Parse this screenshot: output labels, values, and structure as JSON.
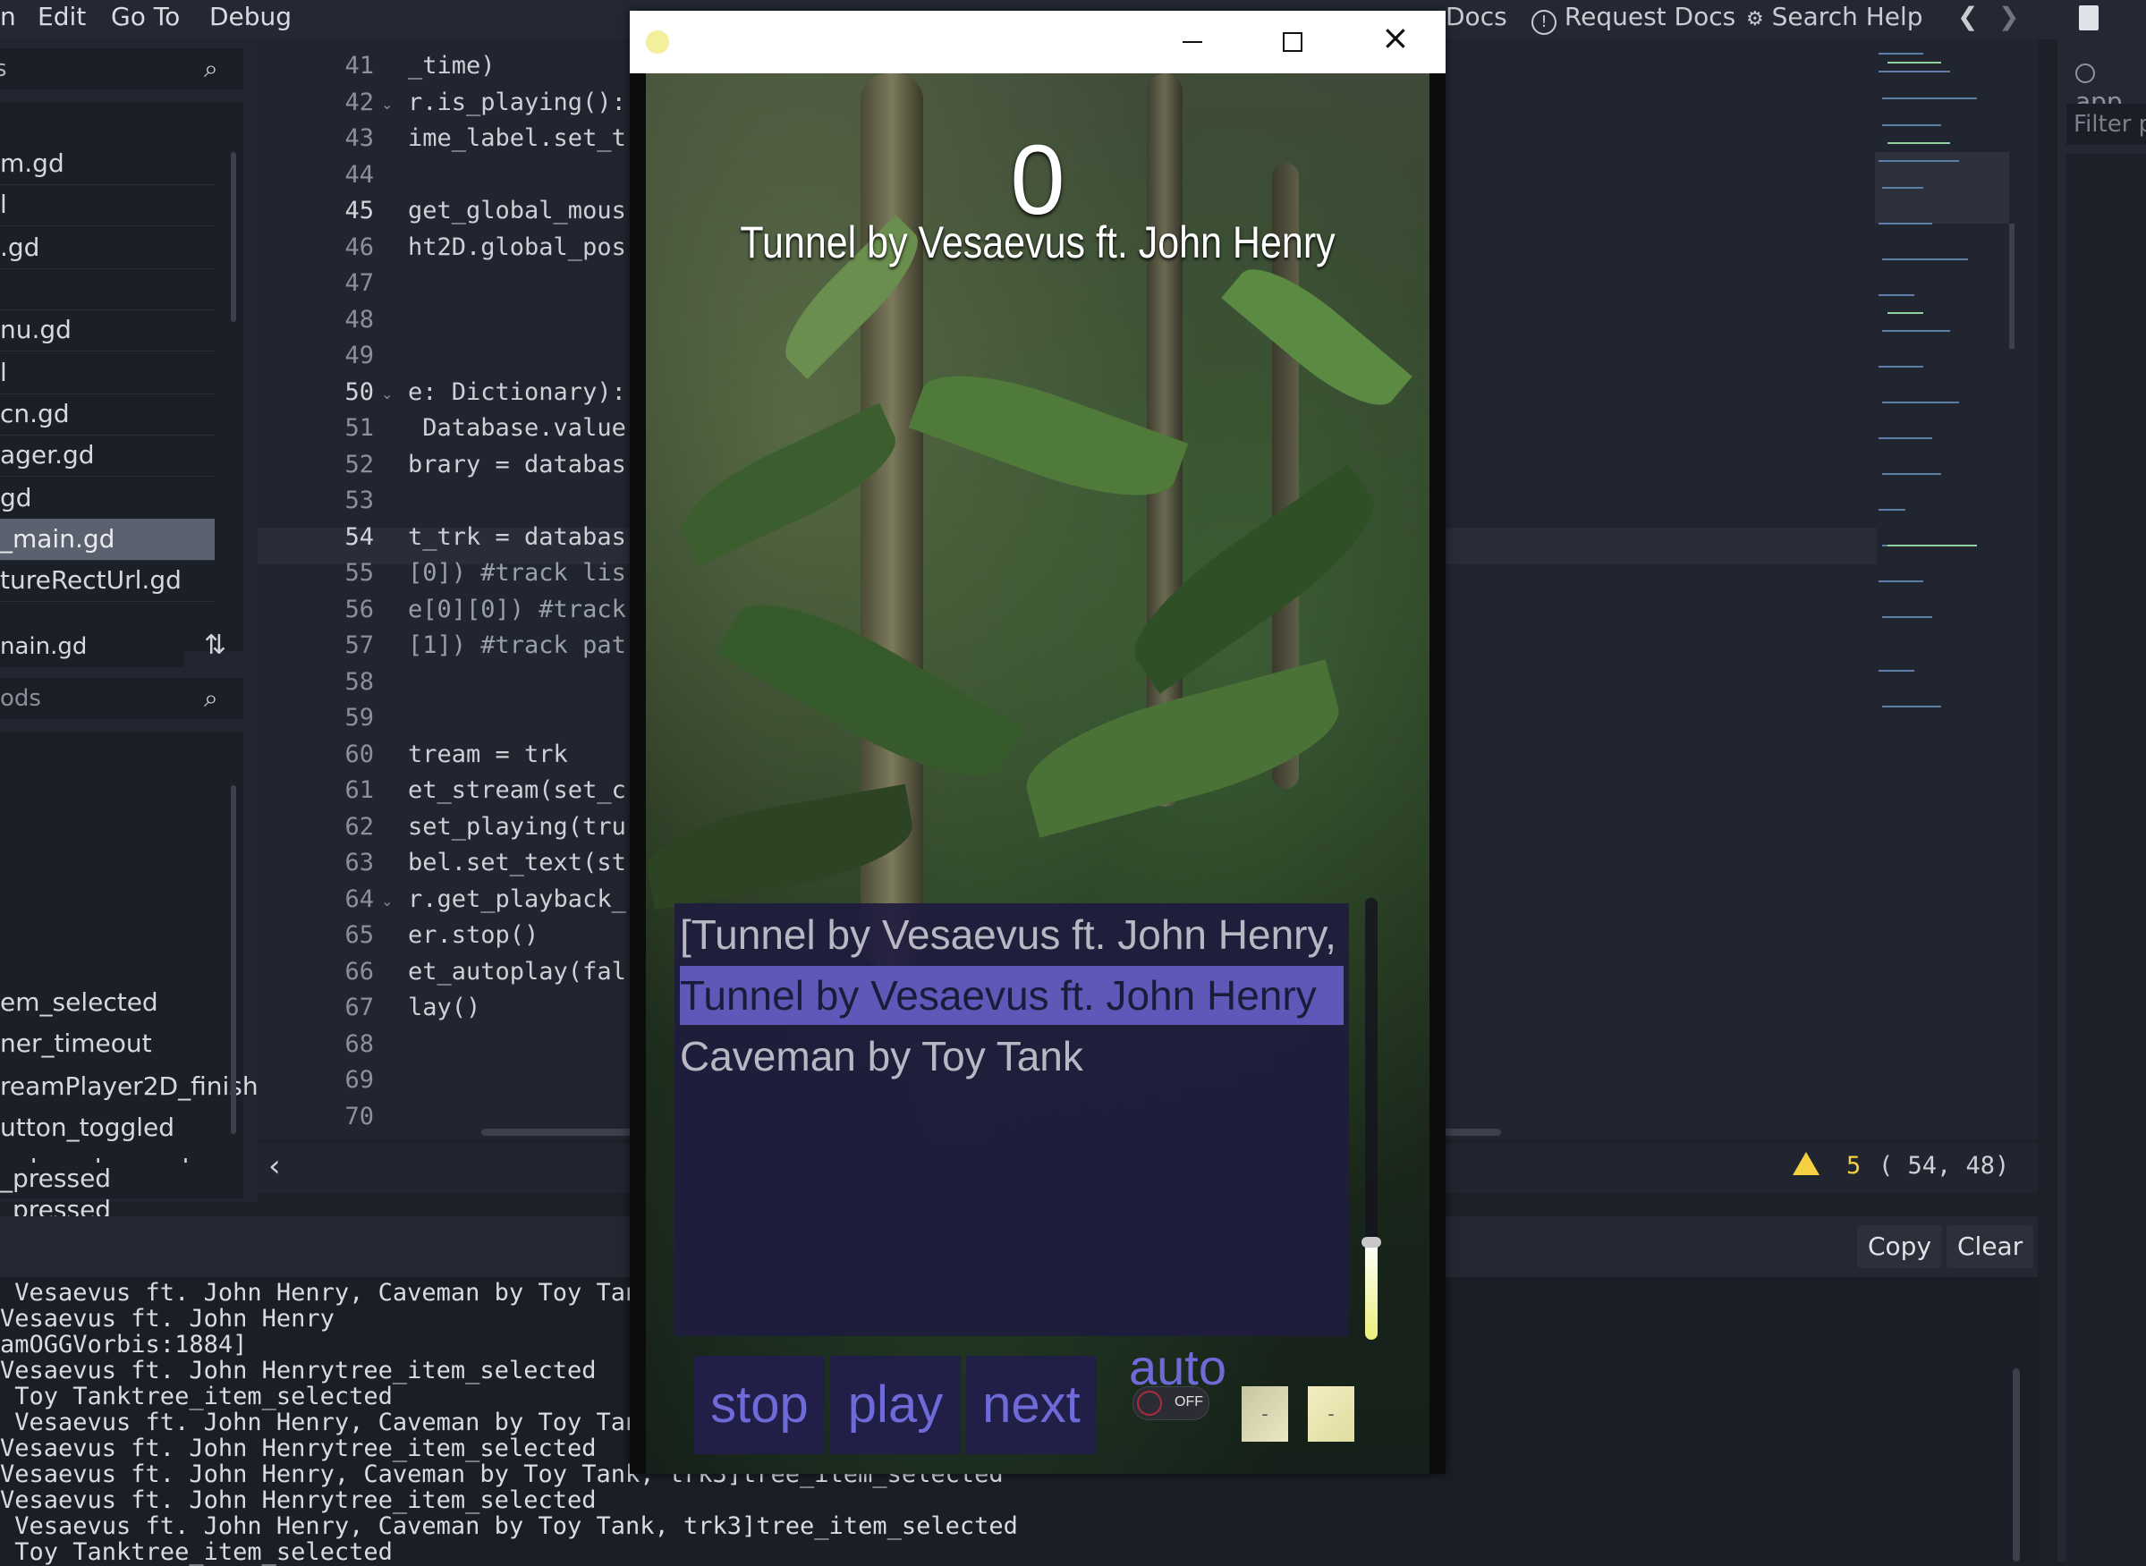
{
  "menu": {
    "items": [
      "n",
      "Edit",
      "Go To",
      "Debug"
    ]
  },
  "topright": {
    "online_docs": "Docs",
    "request_docs": "Request Docs",
    "search_help": "Search Help",
    "back": "❮",
    "forward": "❯"
  },
  "filesystem": {
    "files": [
      "m.gd",
      "l",
      ".gd",
      "",
      "nu.gd",
      "l",
      "cn.gd",
      "ager.gd",
      "gd",
      "_main.gd",
      "tureRectUrl.gd"
    ],
    "selected_index": 9,
    "current_script": "nain.gd",
    "filter_placeholder": "ods"
  },
  "methods": [
    "em_selected",
    "ner_timeout",
    "reamPlayer2D_finish",
    "utton_toggled",
    "value_changed",
    "_pressed"
  ],
  "editor": {
    "lines": [
      {
        "n": "41",
        "code": "_time)"
      },
      {
        "n": "42",
        "code": "r.is_playing():"
      },
      {
        "n": "43",
        "code": "ime_label.set_t"
      },
      {
        "n": "44",
        "code": ""
      },
      {
        "n": "45",
        "code": "get_global_mous"
      },
      {
        "n": "46",
        "code": "ht2D.global_pos"
      },
      {
        "n": "47",
        "code": ""
      },
      {
        "n": "48",
        "code": ""
      },
      {
        "n": "49",
        "code": ""
      },
      {
        "n": "50",
        "code": "e: Dictionary):"
      },
      {
        "n": "51",
        "code": " Database.value"
      },
      {
        "n": "52",
        "code": "brary = databas"
      },
      {
        "n": "53",
        "code": ""
      },
      {
        "n": "54",
        "code": "t_trk = databas"
      },
      {
        "n": "55",
        "code": "[0]) #track lis"
      },
      {
        "n": "56",
        "code": "e[0][0]) #track"
      },
      {
        "n": "57",
        "code": "[1]) #track pat"
      },
      {
        "n": "58",
        "code": ""
      },
      {
        "n": "59",
        "code": ""
      },
      {
        "n": "60",
        "code": "tream = trk"
      },
      {
        "n": "61",
        "code": "et_stream(set_c"
      },
      {
        "n": "62",
        "code": "set_playing(tru"
      },
      {
        "n": "63",
        "code": "bel.set_text(st"
      },
      {
        "n": "64",
        "code": "r.get_playback_"
      },
      {
        "n": "65",
        "code": "er.stop()"
      },
      {
        "n": "66",
        "code": "et_autoplay(fal"
      },
      {
        "n": "67",
        "code": "lay()"
      },
      {
        "n": "68",
        "code": ""
      },
      {
        "n": "69",
        "code": ""
      },
      {
        "n": "70",
        "code": ""
      }
    ],
    "warnings": "5",
    "cursor": "( 54, 48)"
  },
  "output": {
    "copy_label": "Copy",
    "clear_label": "Clear",
    "lines": [
      " Vesaevus ft. John Henry, Caveman by Toy Tan",
      "Vesaevus ft. John Henry",
      "amOGGVorbis:1884]",
      "Vesaevus ft. John Henrytree_item_selected",
      " Toy Tanktree_item_selected",
      " Vesaevus ft. John Henry, Caveman by Toy Tan",
      "Vesaevus ft. John Henrytree_item_selected",
      "Vesaevus ft. John Henry, Caveman by Toy Tank, trk3]tree_item_selected",
      "Vesaevus ft. John Henrytree_item_selected",
      " Vesaevus ft. John Henry, Caveman by Toy Tank, trk3]tree_item_selected",
      " Toy Tanktree_item_selected"
    ]
  },
  "rightdock": {
    "app_label": "app",
    "filter_placeholder": "Filter p"
  },
  "game": {
    "counter": "0",
    "now_playing": "Tunnel by Vesaevus ft. John Henry",
    "tracks": [
      "[Tunnel by Vesaevus ft. John Henry, Cave",
      "Tunnel by Vesaevus ft. John Henry",
      "Caveman by Toy Tank"
    ],
    "selected_track": 1,
    "buttons": {
      "stop": "stop",
      "play": "play",
      "next": "next",
      "auto": "auto",
      "toggle_state": "OFF",
      "minus_a": "-",
      "minus_b": "-"
    },
    "volume": 0.22
  },
  "colors": {
    "accent_selected": "#6058b8",
    "button_bg": "#211f47",
    "button_text": "#6e6ad8",
    "warning": "#f5d142"
  }
}
